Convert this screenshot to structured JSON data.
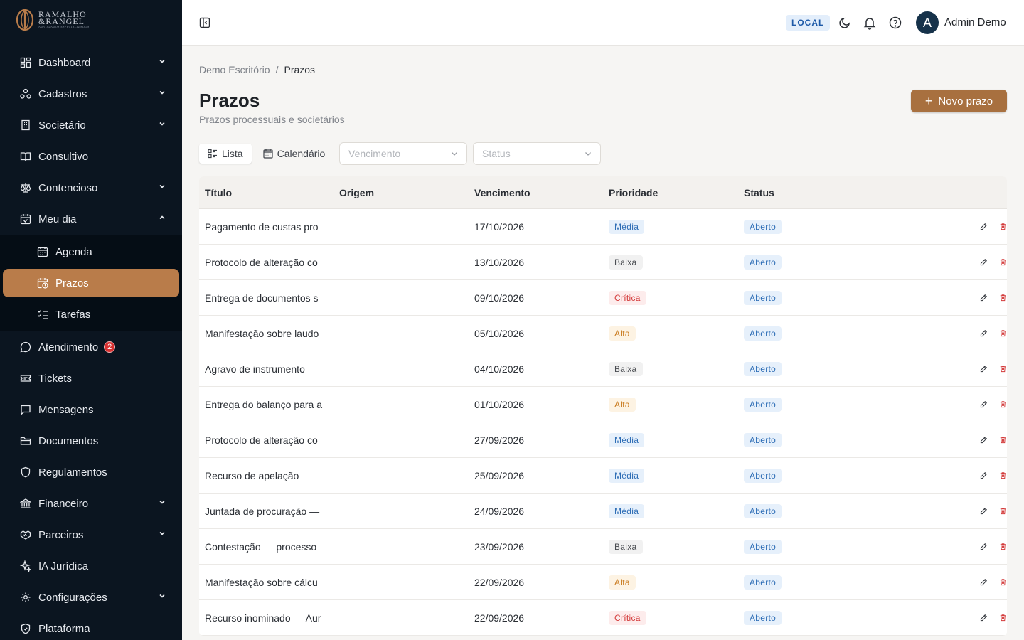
{
  "brand": {
    "line1": "RAMALHO",
    "line2": "&RANGEL",
    "line3": "ADVOGADOS ESPECIALIZADOS"
  },
  "sidebar": {
    "items": [
      {
        "label": "Dashboard",
        "icon": "dashboard-icon",
        "expandable": true
      },
      {
        "label": "Cadastros",
        "icon": "cadastros-icon",
        "expandable": true
      },
      {
        "label": "Societário",
        "icon": "building-icon",
        "expandable": true
      },
      {
        "label": "Consultivo",
        "icon": "book-icon",
        "expandable": false
      },
      {
        "label": "Contencioso",
        "icon": "scale-icon",
        "expandable": true
      },
      {
        "label": "Meu dia",
        "icon": "calendar-check-icon",
        "expanded": true
      }
    ],
    "sub_items": [
      {
        "label": "Agenda",
        "icon": "calendar-icon"
      },
      {
        "label": "Prazos",
        "icon": "calendar-clock-icon",
        "active": true
      },
      {
        "label": "Tarefas",
        "icon": "list-checks-icon"
      }
    ],
    "items_after": [
      {
        "label": "Atendimento",
        "icon": "chat-icon",
        "badge": "2"
      },
      {
        "label": "Tickets",
        "icon": "ticket-icon"
      },
      {
        "label": "Mensagens",
        "icon": "message-icon"
      },
      {
        "label": "Documentos",
        "icon": "folder-icon"
      },
      {
        "label": "Regulamentos",
        "icon": "shield-icon"
      },
      {
        "label": "Financeiro",
        "icon": "bank-icon",
        "expandable": true
      },
      {
        "label": "Parceiros",
        "icon": "handshake-icon",
        "expandable": true
      },
      {
        "label": "IA Jurídica",
        "icon": "sparkles-icon"
      },
      {
        "label": "Configurações",
        "icon": "gear-icon",
        "expandable": true
      },
      {
        "label": "Plataforma",
        "icon": "shield-check-icon"
      }
    ]
  },
  "topbar": {
    "env_label": "LOCAL",
    "avatar_initial": "A",
    "user_name": "Admin Demo"
  },
  "breadcrumb": {
    "root": "Demo Escritório",
    "separator": "/",
    "current": "Prazos"
  },
  "page": {
    "title": "Prazos",
    "subtitle": "Prazos processuais e societários",
    "new_button": "Novo prazo"
  },
  "views": {
    "list": "Lista",
    "calendar": "Calendário"
  },
  "filters": {
    "vencimento_placeholder": "Vencimento",
    "status_placeholder": "Status"
  },
  "table": {
    "headers": [
      "Título",
      "Origem",
      "Vencimento",
      "Prioridade",
      "Status"
    ],
    "rows": [
      {
        "titulo": "Pagamento de custas pro",
        "origem": "",
        "vencimento": "17/10/2026",
        "prioridade": "Média",
        "prio_class": "media",
        "status": "Aberto"
      },
      {
        "titulo": "Protocolo de alteração co",
        "origem": "",
        "vencimento": "13/10/2026",
        "prioridade": "Baixa",
        "prio_class": "baixa",
        "status": "Aberto"
      },
      {
        "titulo": "Entrega de documentos s",
        "origem": "",
        "vencimento": "09/10/2026",
        "prioridade": "Crítica",
        "prio_class": "critica",
        "status": "Aberto"
      },
      {
        "titulo": "Manifestação sobre laudo",
        "origem": "",
        "vencimento": "05/10/2026",
        "prioridade": "Alta",
        "prio_class": "alta",
        "status": "Aberto"
      },
      {
        "titulo": "Agravo de instrumento —",
        "origem": "",
        "vencimento": "04/10/2026",
        "prioridade": "Baixa",
        "prio_class": "baixa",
        "status": "Aberto"
      },
      {
        "titulo": "Entrega do balanço para a",
        "origem": "",
        "vencimento": "01/10/2026",
        "prioridade": "Alta",
        "prio_class": "alta",
        "status": "Aberto"
      },
      {
        "titulo": "Protocolo de alteração co",
        "origem": "",
        "vencimento": "27/09/2026",
        "prioridade": "Média",
        "prio_class": "media",
        "status": "Aberto"
      },
      {
        "titulo": "Recurso de apelação",
        "origem": "",
        "vencimento": "25/09/2026",
        "prioridade": "Média",
        "prio_class": "media",
        "status": "Aberto"
      },
      {
        "titulo": "Juntada de procuração —",
        "origem": "",
        "vencimento": "24/09/2026",
        "prioridade": "Média",
        "prio_class": "media",
        "status": "Aberto"
      },
      {
        "titulo": "Contestação — processo",
        "origem": "",
        "vencimento": "23/09/2026",
        "prioridade": "Baixa",
        "prio_class": "baixa",
        "status": "Aberto"
      },
      {
        "titulo": "Manifestação sobre cálcu",
        "origem": "",
        "vencimento": "22/09/2026",
        "prioridade": "Alta",
        "prio_class": "alta",
        "status": "Aberto"
      },
      {
        "titulo": "Recurso inominado — Aur",
        "origem": "",
        "vencimento": "22/09/2026",
        "prioridade": "Crítica",
        "prio_class": "critica",
        "status": "Aberto"
      }
    ]
  },
  "colors": {
    "sidebar_bg": "#0b1520",
    "accent": "#b97c4a",
    "button": "#a8703f",
    "delete": "#d33a3a"
  }
}
